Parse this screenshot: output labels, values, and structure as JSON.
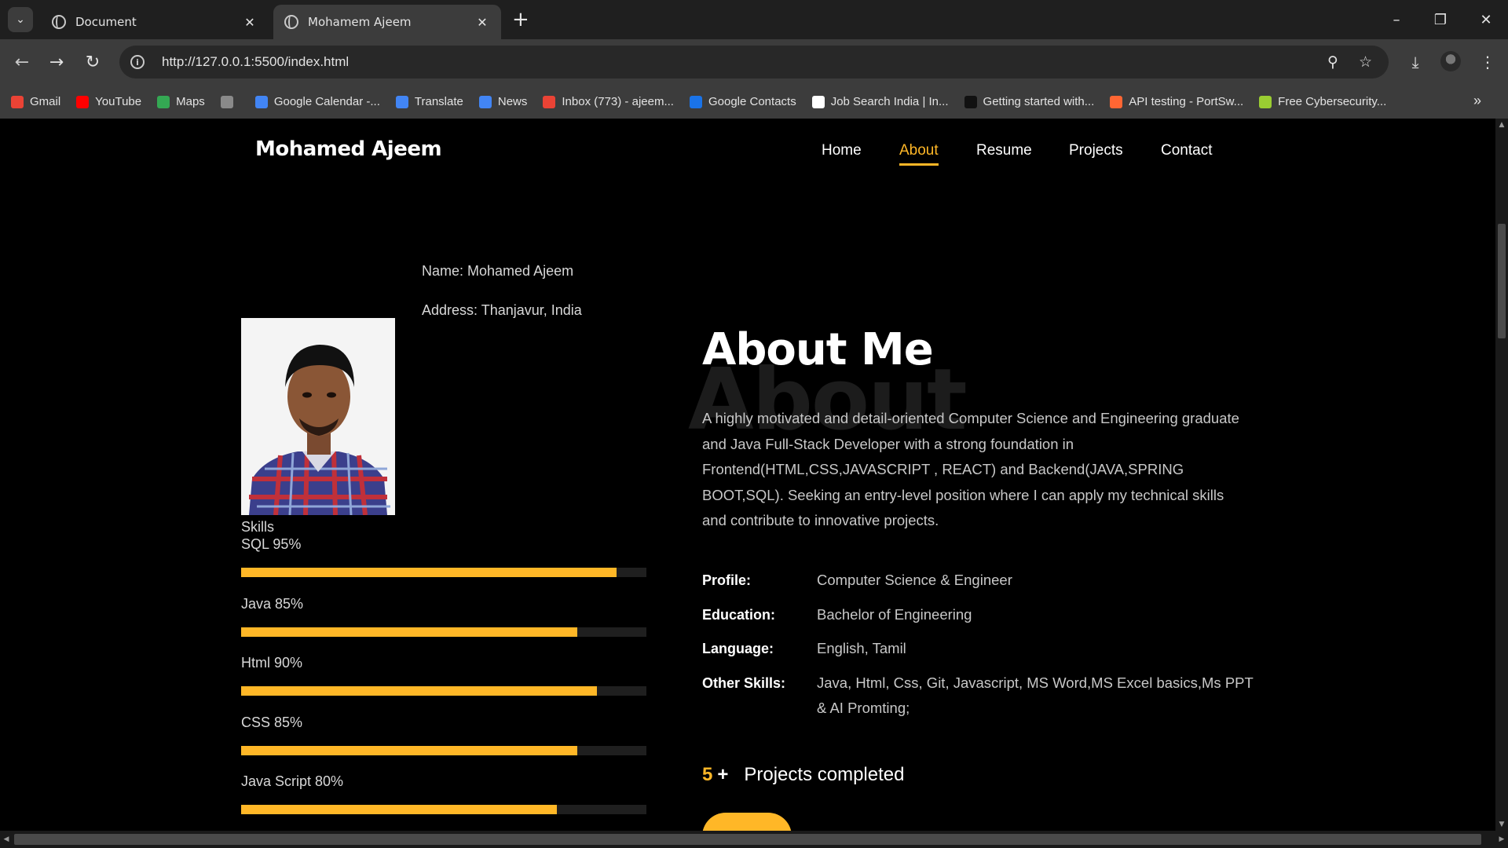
{
  "browser": {
    "tabs": [
      {
        "label": "Document",
        "active": false
      },
      {
        "label": "Mohamem Ajeem",
        "active": true
      }
    ],
    "url": "http://127.0.0.1:5500/index.html",
    "bookmarks": [
      {
        "label": "Gmail",
        "color": "#ea4335"
      },
      {
        "label": "YouTube",
        "color": "#ff0000"
      },
      {
        "label": "Maps",
        "color": "#34a853"
      },
      {
        "label": "",
        "color": "#8a8a8a"
      },
      {
        "label": "Google Calendar -...",
        "color": "#4285f4"
      },
      {
        "label": "Translate",
        "color": "#4285f4"
      },
      {
        "label": "News",
        "color": "#4285f4"
      },
      {
        "label": "Inbox (773) - ajeem...",
        "color": "#ea4335"
      },
      {
        "label": "Google Contacts",
        "color": "#1a73e8"
      },
      {
        "label": "Job Search India | In...",
        "color": "#ffffff"
      },
      {
        "label": "Getting started with...",
        "color": "#111111"
      },
      {
        "label": "API testing - PortSw...",
        "color": "#ff6633"
      },
      {
        "label": "Free Cybersecurity...",
        "color": "#9acd32"
      }
    ]
  },
  "site": {
    "brand": "Mohamed Ajeem",
    "nav": [
      "Home",
      "About",
      "Resume",
      "Projects",
      "Contact"
    ],
    "active_nav": "About",
    "accent": "#ffb727"
  },
  "about": {
    "name_line": "Name: Mohamed Ajeem",
    "address_line": "Address: Thanjavur, India",
    "skills_title": "Skills",
    "skills": [
      {
        "label": "SQL 95%",
        "level": 0.95
      },
      {
        "label": "Java 85%",
        "level": 0.85
      },
      {
        "label": "Html 90%",
        "level": 0.9
      },
      {
        "label": "CSS 85%",
        "level": 0.85
      },
      {
        "label": "Java Script 80%",
        "level": 0.8
      }
    ],
    "bg_word": "About",
    "title": "About Me",
    "description": "A highly motivated and detail-oriented Computer Science and Engineering graduate and Java Full-Stack Developer with a strong foundation in Frontend(HTML,CSS,JAVASCRIPT , REACT) and Backend(JAVA,SPRING BOOT,SQL). Seeking an entry-level position where I can apply my technical skills and contribute to innovative projects.",
    "details": [
      {
        "label": "Profile:",
        "value": "Computer Science & Engineer"
      },
      {
        "label": "Education:",
        "value": "Bachelor of Engineering"
      },
      {
        "label": "Language:",
        "value": "English, Tamil"
      },
      {
        "label": "Other Skills:",
        "value": "Java, Html, Css, Git, Javascript, MS Word,MS Excel basics,Ms PPT & AI Promting;"
      }
    ],
    "projects_count": "5",
    "projects_plus": "+",
    "projects_label": "Projects completed"
  }
}
